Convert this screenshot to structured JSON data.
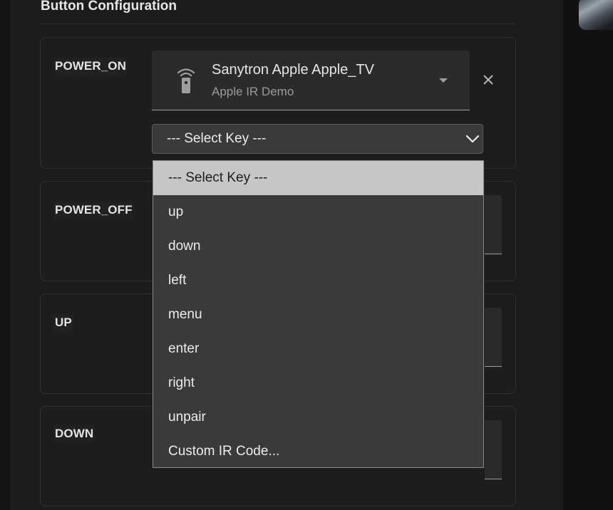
{
  "section": {
    "title": "Button Configuration"
  },
  "cards": [
    {
      "label": "POWER_ON"
    },
    {
      "label": "POWER_OFF"
    },
    {
      "label": "UP"
    },
    {
      "label": "DOWN"
    }
  ],
  "entity": {
    "name": "Sanytron Apple Apple_TV",
    "subtitle": "Apple IR Demo",
    "icon": "remote-icon"
  },
  "key_select": {
    "value": "--- Select Key ---",
    "options": [
      "--- Select Key ---",
      "up",
      "down",
      "left",
      "menu",
      "enter",
      "right",
      "unpair",
      "Custom IR Code..."
    ]
  },
  "colors": {
    "background": "#1c1c1c",
    "card": "#1d1d1d",
    "field": "#2b2b2b",
    "select": "#3a3a3a",
    "selected_option": "#c6c6c6"
  }
}
